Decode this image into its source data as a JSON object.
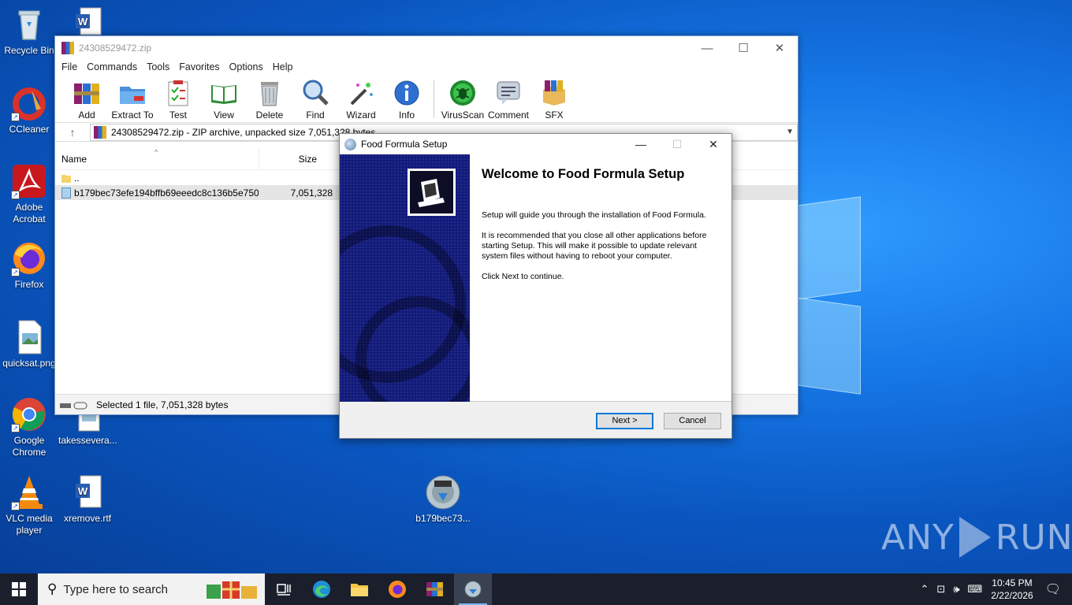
{
  "desktop": {
    "icons": [
      {
        "label": "Recycle Bin"
      },
      {
        "label": "CCleaner"
      },
      {
        "label": "Adobe Acrobat"
      },
      {
        "label": "Firefox"
      },
      {
        "label": "quicksat.png"
      },
      {
        "label": "Google Chrome"
      },
      {
        "label": "VLC media player"
      },
      {
        "label": "takessevera..."
      },
      {
        "label": "xremove.rtf"
      },
      {
        "label": "b179bec73..."
      }
    ]
  },
  "winrar": {
    "title": "24308529472.zip",
    "menu": [
      "File",
      "Commands",
      "Tools",
      "Favorites",
      "Options",
      "Help"
    ],
    "toolbar": [
      "Add",
      "Extract To",
      "Test",
      "View",
      "Delete",
      "Find",
      "Wizard",
      "Info",
      "VirusScan",
      "Comment",
      "SFX"
    ],
    "address": "24308529472.zip - ZIP archive, unpacked size 7,051,328 bytes",
    "columns": {
      "name": "Name",
      "size": "Size"
    },
    "files": [
      {
        "name": "..",
        "size": ""
      },
      {
        "name": "b179bec73efe194bffb69eeedc8c136b5e750...",
        "size": "7,051,328"
      }
    ],
    "status": "Selected 1 file, 7,051,328 bytes"
  },
  "setup": {
    "title": "Food Formula Setup",
    "heading": "Welcome to Food Formula Setup",
    "para1": "Setup will guide you through the installation of Food Formula.",
    "para2": "It is recommended that you close all other applications before starting Setup. This will make it possible to update relevant system files without having to reboot your computer.",
    "para3": "Click Next to continue.",
    "next_label": "Next >",
    "cancel_label": "Cancel"
  },
  "taskbar": {
    "search_placeholder": "Type here to search",
    "time": "10:45 PM",
    "date": "2/22/2026"
  },
  "watermark": {
    "left": "ANY",
    "right": "RUN"
  }
}
